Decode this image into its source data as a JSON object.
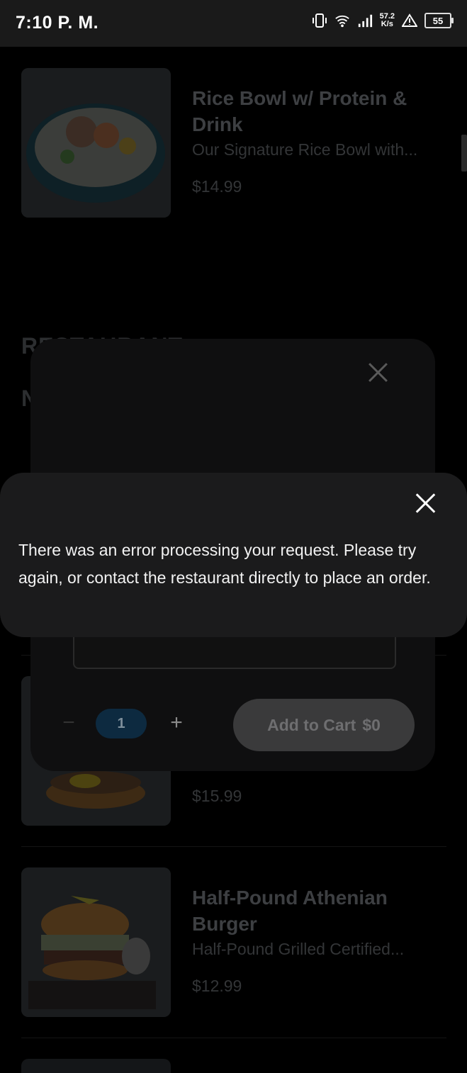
{
  "status_bar": {
    "time": "7:10 P. M.",
    "net_speed": "57.2",
    "net_unit": "K/s",
    "battery": "55"
  },
  "menu": {
    "items": [
      {
        "title": "Rice Bowl w/ Protein & Drink",
        "description": "Our Signature Rice Bowl with...",
        "price": "$14.99"
      },
      {
        "price": "$15.99"
      },
      {
        "title": "Half-Pound Athenian Burger",
        "description": "Half-Pound Grilled Certified...",
        "price": "$12.99"
      }
    ],
    "section_title": "RESTAURANT",
    "section_subtitle": "N"
  },
  "item_dialog": {
    "quantity": "1",
    "minus_label": "−",
    "plus_label": "+",
    "add_to_cart_label": "Add to Cart",
    "add_to_cart_price": "$0"
  },
  "error_toast": {
    "message": "There was an error processing your request. Please try again, or contact the restaurant directly to place an order."
  }
}
